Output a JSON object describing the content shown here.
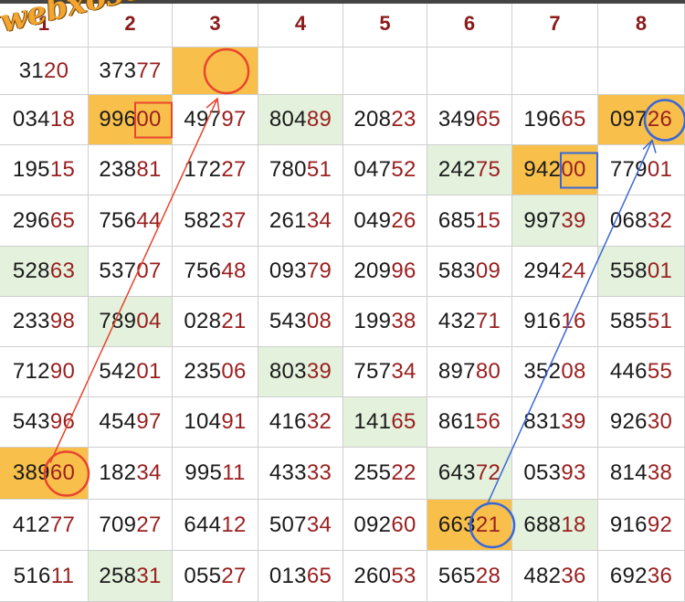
{
  "watermark": "webxoso.net",
  "columns": [
    "1",
    "2",
    "3",
    "4",
    "5",
    "6",
    "7",
    "8"
  ],
  "rows": [
    [
      {
        "p": "31",
        "s": "20"
      },
      {
        "p": "373",
        "s": "77"
      },
      {
        "p": "",
        "s": "",
        "hl": "orange"
      },
      {
        "p": "",
        "s": ""
      },
      {
        "p": "",
        "s": ""
      },
      {
        "p": "",
        "s": ""
      },
      {
        "p": "",
        "s": ""
      },
      {
        "p": "",
        "s": ""
      }
    ],
    [
      {
        "p": "034",
        "s": "18"
      },
      {
        "p": "996",
        "s": "00",
        "hl": "orange"
      },
      {
        "p": "497",
        "s": "97"
      },
      {
        "p": "804",
        "s": "89",
        "hl": "green"
      },
      {
        "p": "208",
        "s": "23"
      },
      {
        "p": "349",
        "s": "65"
      },
      {
        "p": "196",
        "s": "65"
      },
      {
        "p": "097",
        "s": "26",
        "hl": "orange"
      }
    ],
    [
      {
        "p": "195",
        "s": "15"
      },
      {
        "p": "238",
        "s": "81"
      },
      {
        "p": "172",
        "s": "27"
      },
      {
        "p": "780",
        "s": "51"
      },
      {
        "p": "047",
        "s": "52"
      },
      {
        "p": "242",
        "s": "75",
        "hl": "green"
      },
      {
        "p": "942",
        "s": "00",
        "hl": "orange"
      },
      {
        "p": "779",
        "s": "01"
      }
    ],
    [
      {
        "p": "296",
        "s": "65"
      },
      {
        "p": "756",
        "s": "44"
      },
      {
        "p": "582",
        "s": "37"
      },
      {
        "p": "261",
        "s": "34"
      },
      {
        "p": "049",
        "s": "26"
      },
      {
        "p": "685",
        "s": "15"
      },
      {
        "p": "997",
        "s": "39",
        "hl": "green"
      },
      {
        "p": "068",
        "s": "32"
      }
    ],
    [
      {
        "p": "528",
        "s": "63",
        "hl": "green"
      },
      {
        "p": "537",
        "s": "07"
      },
      {
        "p": "756",
        "s": "48"
      },
      {
        "p": "093",
        "s": "79"
      },
      {
        "p": "209",
        "s": "96"
      },
      {
        "p": "583",
        "s": "09"
      },
      {
        "p": "294",
        "s": "24"
      },
      {
        "p": "558",
        "s": "01",
        "hl": "green"
      }
    ],
    [
      {
        "p": "233",
        "s": "98"
      },
      {
        "p": "789",
        "s": "04",
        "hl": "green"
      },
      {
        "p": "028",
        "s": "21"
      },
      {
        "p": "543",
        "s": "08"
      },
      {
        "p": "199",
        "s": "38"
      },
      {
        "p": "432",
        "s": "71"
      },
      {
        "p": "916",
        "s": "16"
      },
      {
        "p": "585",
        "s": "51"
      }
    ],
    [
      {
        "p": "712",
        "s": "90"
      },
      {
        "p": "542",
        "s": "01"
      },
      {
        "p": "235",
        "s": "06"
      },
      {
        "p": "803",
        "s": "39",
        "hl": "green"
      },
      {
        "p": "757",
        "s": "34"
      },
      {
        "p": "897",
        "s": "80"
      },
      {
        "p": "352",
        "s": "08"
      },
      {
        "p": "446",
        "s": "55"
      }
    ],
    [
      {
        "p": "543",
        "s": "96"
      },
      {
        "p": "454",
        "s": "97"
      },
      {
        "p": "104",
        "s": "91"
      },
      {
        "p": "416",
        "s": "32"
      },
      {
        "p": "141",
        "s": "65",
        "hl": "green"
      },
      {
        "p": "861",
        "s": "56"
      },
      {
        "p": "831",
        "s": "39"
      },
      {
        "p": "926",
        "s": "30"
      }
    ],
    [
      {
        "p": "389",
        "s": "60",
        "hl": "orange"
      },
      {
        "p": "182",
        "s": "34"
      },
      {
        "p": "995",
        "s": "11"
      },
      {
        "p": "433",
        "s": "33"
      },
      {
        "p": "255",
        "s": "22"
      },
      {
        "p": "643",
        "s": "72",
        "hl": "green"
      },
      {
        "p": "053",
        "s": "93"
      },
      {
        "p": "814",
        "s": "38"
      }
    ],
    [
      {
        "p": "412",
        "s": "77"
      },
      {
        "p": "709",
        "s": "27"
      },
      {
        "p": "644",
        "s": "12"
      },
      {
        "p": "507",
        "s": "34"
      },
      {
        "p": "092",
        "s": "60"
      },
      {
        "p": "663",
        "s": "21",
        "hl": "orange"
      },
      {
        "p": "688",
        "s": "18",
        "hl": "green"
      },
      {
        "p": "916",
        "s": "92"
      }
    ],
    [
      {
        "p": "516",
        "s": "11"
      },
      {
        "p": "258",
        "s": "31",
        "hl": "green"
      },
      {
        "p": "055",
        "s": "27"
      },
      {
        "p": "013",
        "s": "65"
      },
      {
        "p": "260",
        "s": "53"
      },
      {
        "p": "565",
        "s": "28"
      },
      {
        "p": "482",
        "s": "36"
      },
      {
        "p": "692",
        "s": "36"
      }
    ]
  ],
  "annotations": {
    "red_color": "#e8452f",
    "blue_color": "#3a67d8",
    "red_path": {
      "from_cell": [
        8,
        0
      ],
      "to_cell": [
        0,
        2
      ]
    },
    "blue_path": {
      "from_cell": [
        9,
        5
      ],
      "to_cell": [
        1,
        7
      ]
    },
    "red_square_cell": [
      1,
      1
    ],
    "blue_square_cell": [
      2,
      6
    ]
  }
}
